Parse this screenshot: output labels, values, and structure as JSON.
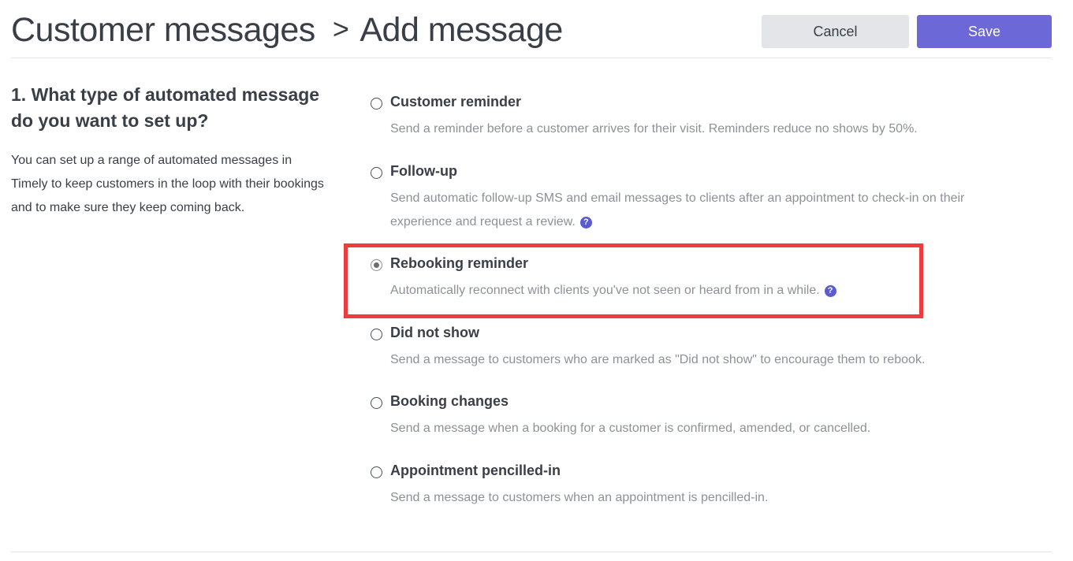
{
  "header": {
    "breadcrumb_parent": "Customer messages",
    "breadcrumb_separator": ">",
    "breadcrumb_current": "Add message",
    "cancel_label": "Cancel",
    "save_label": "Save"
  },
  "section": {
    "title": "1. What type of automated message do you want to set up?",
    "description": "You can set up a range of automated messages in Timely to keep customers in the loop with their bookings and to make sure they keep coming back."
  },
  "options": [
    {
      "label": "Customer reminder",
      "description": "Send a reminder before a customer arrives for their visit. Reminders reduce no shows by 50%.",
      "selected": false,
      "has_help": false
    },
    {
      "label": "Follow-up",
      "description": "Send automatic follow-up SMS and email messages to clients after an appointment to check-in on their experience and request a review.",
      "selected": false,
      "has_help": true
    },
    {
      "label": "Rebooking reminder",
      "description": "Automatically reconnect with clients you've not seen or heard from in a while.",
      "selected": true,
      "has_help": true
    },
    {
      "label": "Did not show",
      "description": "Send a message to customers who are marked as \"Did not show\" to encourage them to rebook.",
      "selected": false,
      "has_help": false
    },
    {
      "label": "Booking changes",
      "description": "Send a message when a booking for a customer is confirmed, amended, or cancelled.",
      "selected": false,
      "has_help": false
    },
    {
      "label": "Appointment pencilled-in",
      "description": "Send a message to customers when an appointment is pencilled-in.",
      "selected": false,
      "has_help": false
    }
  ],
  "help_icon_glyph": "?",
  "icons": {
    "help": "question-circle-icon",
    "radio": "radio-button"
  },
  "colors": {
    "primary": "#6c68d8",
    "highlight": "#ee3b3e",
    "help_icon": "#5a5bd0"
  }
}
